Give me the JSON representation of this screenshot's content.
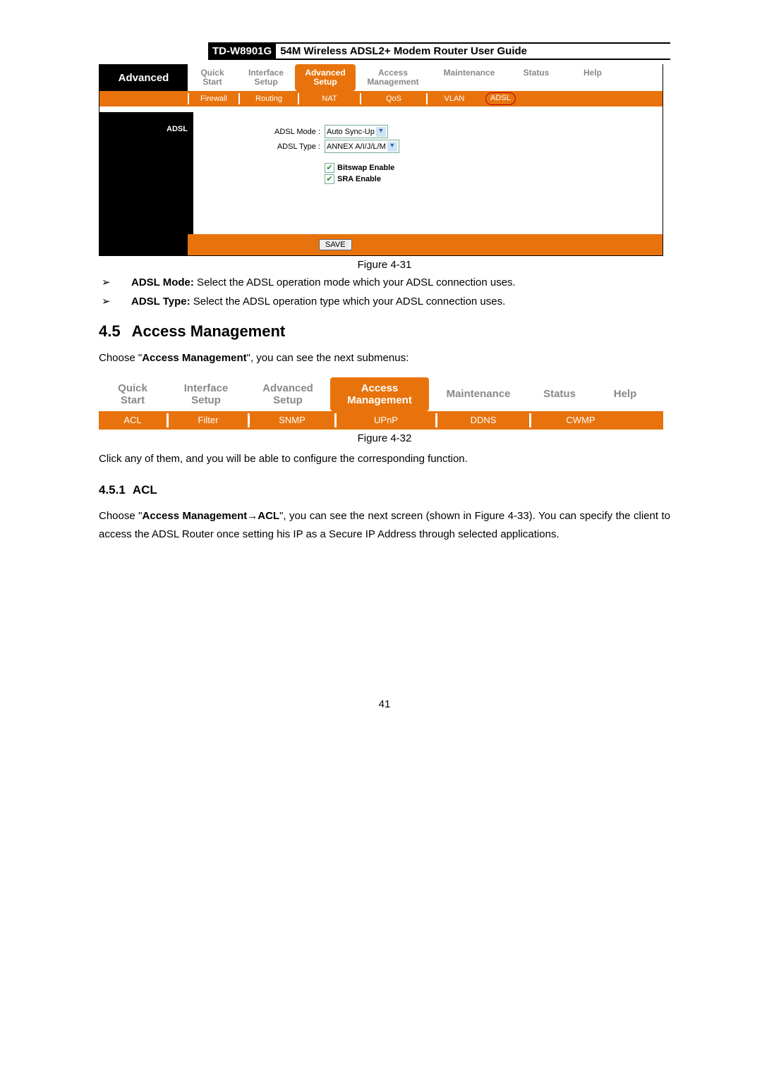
{
  "header": {
    "model": "TD-W8901G",
    "title": "54M Wireless ADSL2+ Modem Router User Guide"
  },
  "figure31": {
    "side_label": "Advanced",
    "tabs": [
      "Quick Start",
      "Interface Setup",
      "Advanced Setup",
      "Access Management",
      "Maintenance",
      "Status",
      "Help"
    ],
    "subtabs": [
      "Firewall",
      "Routing",
      "NAT",
      "QoS",
      "VLAN",
      "ADSL"
    ],
    "section_label": "ADSL",
    "adsl_mode_label": "ADSL Mode :",
    "adsl_mode_value": "Auto Sync-Up",
    "adsl_type_label": "ADSL Type :",
    "adsl_type_value": "ANNEX A/I/J/L/M",
    "bitswap_label": "Bitswap Enable",
    "sra_label": "SRA Enable",
    "save_btn": "SAVE",
    "caption": "Figure 4-31"
  },
  "bullets": {
    "b1_bold": "ADSL Mode:",
    "b1_rest": " Select the ADSL operation mode which your ADSL connection uses.",
    "b2_bold": "ADSL Type:",
    "b2_rest": " Select the ADSL operation type which your ADSL connection uses."
  },
  "section45": {
    "num": "4.5",
    "title": "Access Management",
    "intro_a": "Choose \"",
    "intro_bold": "Access Management",
    "intro_b": "\", you can see the next submenus:"
  },
  "figure32": {
    "tabs": [
      "Quick Start",
      "Interface Setup",
      "Advanced Setup",
      "Access Management",
      "Maintenance",
      "Status",
      "Help"
    ],
    "subtabs": [
      "ACL",
      "Filter",
      "SNMP",
      "UPnP",
      "DDNS",
      "CWMP"
    ],
    "caption": "Figure 4-32"
  },
  "para_click": "Click any of them, and you will be able to configure the corresponding function.",
  "section451": {
    "num": "4.5.1",
    "title": "ACL",
    "p_a": "Choose \"",
    "p_bold1": "Access Management",
    "p_arrow": "→",
    "p_bold2": "ACL",
    "p_b": "\", you can see the next screen (shown in Figure 4-33). You can specify the client to access the ADSL Router once setting his IP as a Secure IP Address through selected applications."
  },
  "page_number": "41"
}
